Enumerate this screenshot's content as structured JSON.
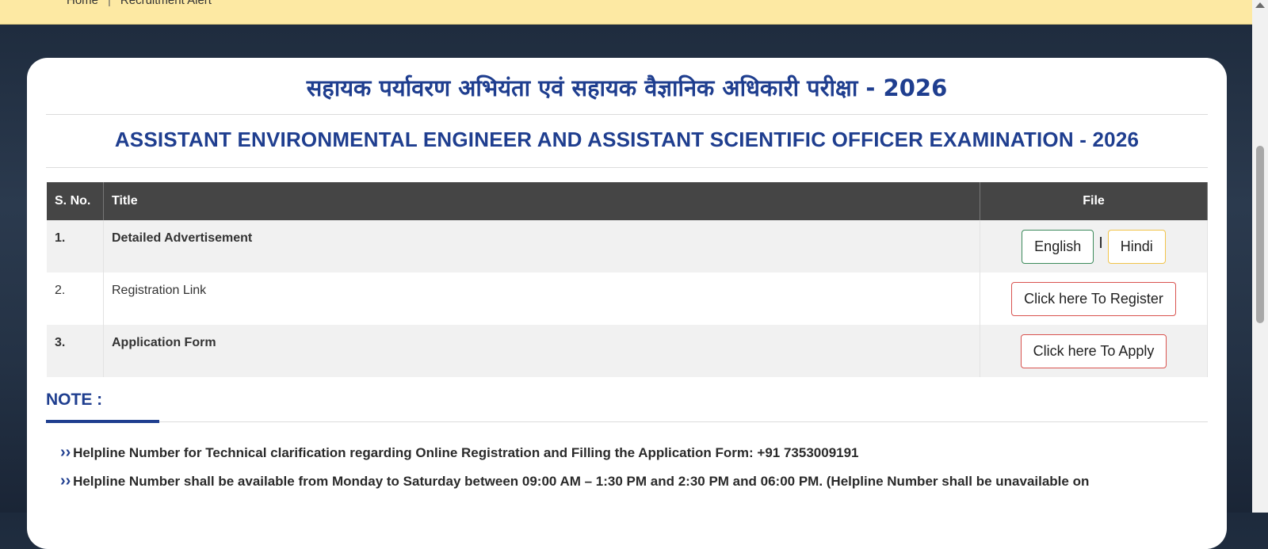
{
  "breadcrumb": {
    "home": "Home",
    "separator": "|",
    "current": "Recruitment Alert"
  },
  "page": {
    "title_hindi": "सहायक पर्यावरण अभियंता एवं सहायक वैज्ञानिक अधिकारी परीक्षा - 2026",
    "title_english": "ASSISTANT ENVIRONMENTAL ENGINEER AND ASSISTANT SCIENTIFIC OFFICER EXAMINATION - 2026"
  },
  "table": {
    "headers": {
      "sno": "S. No.",
      "title": "Title",
      "file": "File"
    },
    "rows": [
      {
        "sno": "1.",
        "title": "Detailed Advertisement",
        "btn1": "English",
        "pipe": "I",
        "btn2": "Hindi"
      },
      {
        "sno": "2.",
        "title": "Registration Link",
        "btn1": "Click here To Register"
      },
      {
        "sno": "3.",
        "title": "Application Form",
        "btn1": "Click here To Apply"
      }
    ]
  },
  "note": {
    "heading": "NOTE :",
    "items": [
      {
        "text": "Helpline Number for Technical clarification regarding Online Registration and Filling the Application Form: ",
        "strong": "+91 7353009191"
      },
      {
        "text": "Helpline Number shall be available from Monday to Saturday between 09:00 AM – 1:30 PM and 2:30 PM and 06:00 PM. (Helpline Number shall be unavailable on"
      }
    ]
  },
  "icons": {
    "bullet": "double-chevron-right-icon",
    "scroll_up": "arrow-up-icon"
  },
  "colors": {
    "primary": "#1f3e8f",
    "topbar": "#fde9a3",
    "table_header": "#454545"
  }
}
